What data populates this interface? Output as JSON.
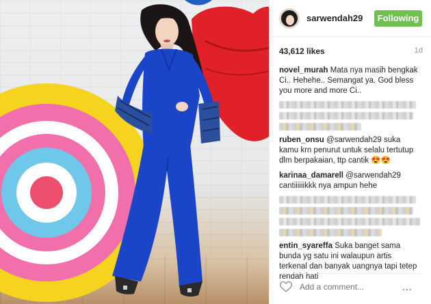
{
  "post": {
    "username": "sarwendah29",
    "follow_label": "Following",
    "likes": "43,612 likes",
    "time": "1d",
    "add_comment_placeholder": "Add a comment...",
    "more_label": "..."
  },
  "comments": [
    {
      "user": "novel_murah",
      "text": "Mata nya masih bengkak Ci.. Hehehe.. Semangat ya. God bless you more and more Ci.."
    },
    {
      "user": "ruben_onsu",
      "mention": "@sarwendah29",
      "text": "suka kamu krn penurut untuk selalu tertutup dlm berpakaian, ttp cantik 😍😍"
    },
    {
      "user": "karinaa_damarell",
      "mention": "@sarwendah29",
      "text": "cantiiiiiikkk nya ampun hehe"
    },
    {
      "user": "entin_syareffa",
      "text": "Suka banget sama bunda yg satu ini walaupun artis terkenal dan banyak uangnya tapi tetep rendah hati"
    }
  ],
  "colors": {
    "follow_green": "#70c050",
    "dress_blue": "#1a45c9"
  }
}
